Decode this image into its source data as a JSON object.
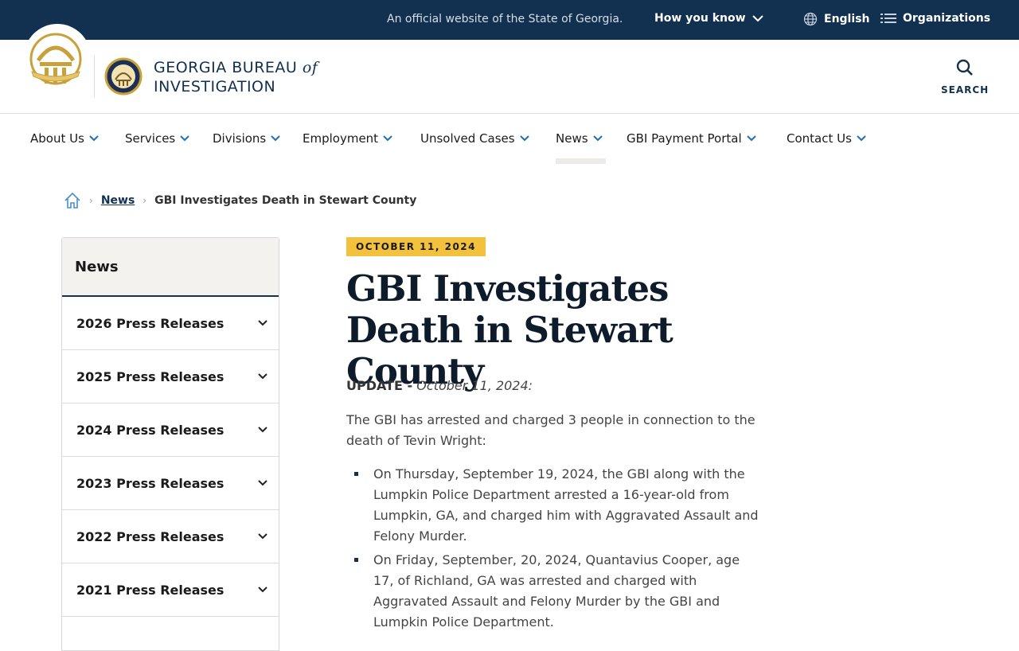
{
  "topbar": {
    "official_text": "An official website of the State of Georgia.",
    "how_you_know": "How you know",
    "language": "English",
    "organizations": "Organizations"
  },
  "header": {
    "brand_line1": "GEORGIA BUREAU",
    "brand_of": "of",
    "brand_line2": "INVESTIGATION",
    "search_label": "SEARCH"
  },
  "nav": {
    "items": [
      {
        "label": "About Us"
      },
      {
        "label": "Services"
      },
      {
        "label": "Divisions"
      },
      {
        "label": "Employment"
      },
      {
        "label": "Unsolved Cases"
      },
      {
        "label": "News"
      },
      {
        "label": "GBI Payment Portal"
      },
      {
        "label": "Contact Us"
      }
    ],
    "active": "News"
  },
  "breadcrumb": {
    "parent": "News",
    "current": "GBI Investigates Death in Stewart County"
  },
  "sidebar": {
    "title": "News",
    "items": [
      {
        "label": "2026 Press Releases"
      },
      {
        "label": "2025 Press Releases"
      },
      {
        "label": "2024 Press Releases"
      },
      {
        "label": "2023 Press Releases"
      },
      {
        "label": "2022 Press Releases"
      },
      {
        "label": "2021 Press Releases"
      }
    ]
  },
  "article": {
    "date": "OCTOBER 11, 2024",
    "title": "GBI Investigates Death in Stewart County",
    "update_label": "UPDATE -",
    "update_date": "October 11, 2024:",
    "intro": "The GBI has arrested and charged 3 people in connection to the death of Tevin Wright:",
    "bullets": [
      "On Thursday, September 19, 2024, the GBI along with the Lumpkin Police Department arrested a 16-year-old from Lumpkin, GA, and charged him with Aggravated Assault and Felony Murder.",
      "On Friday, September, 20, 2024, Quantavius Cooper, age 17, of Richland, GA was arrested and charged with Aggravated Assault and Felony Murder by the GBI and Lumpkin Police Department."
    ]
  },
  "colors": {
    "navy": "#12304f",
    "gold": "#f2c13e",
    "seal_gold": "#c9a13b"
  }
}
